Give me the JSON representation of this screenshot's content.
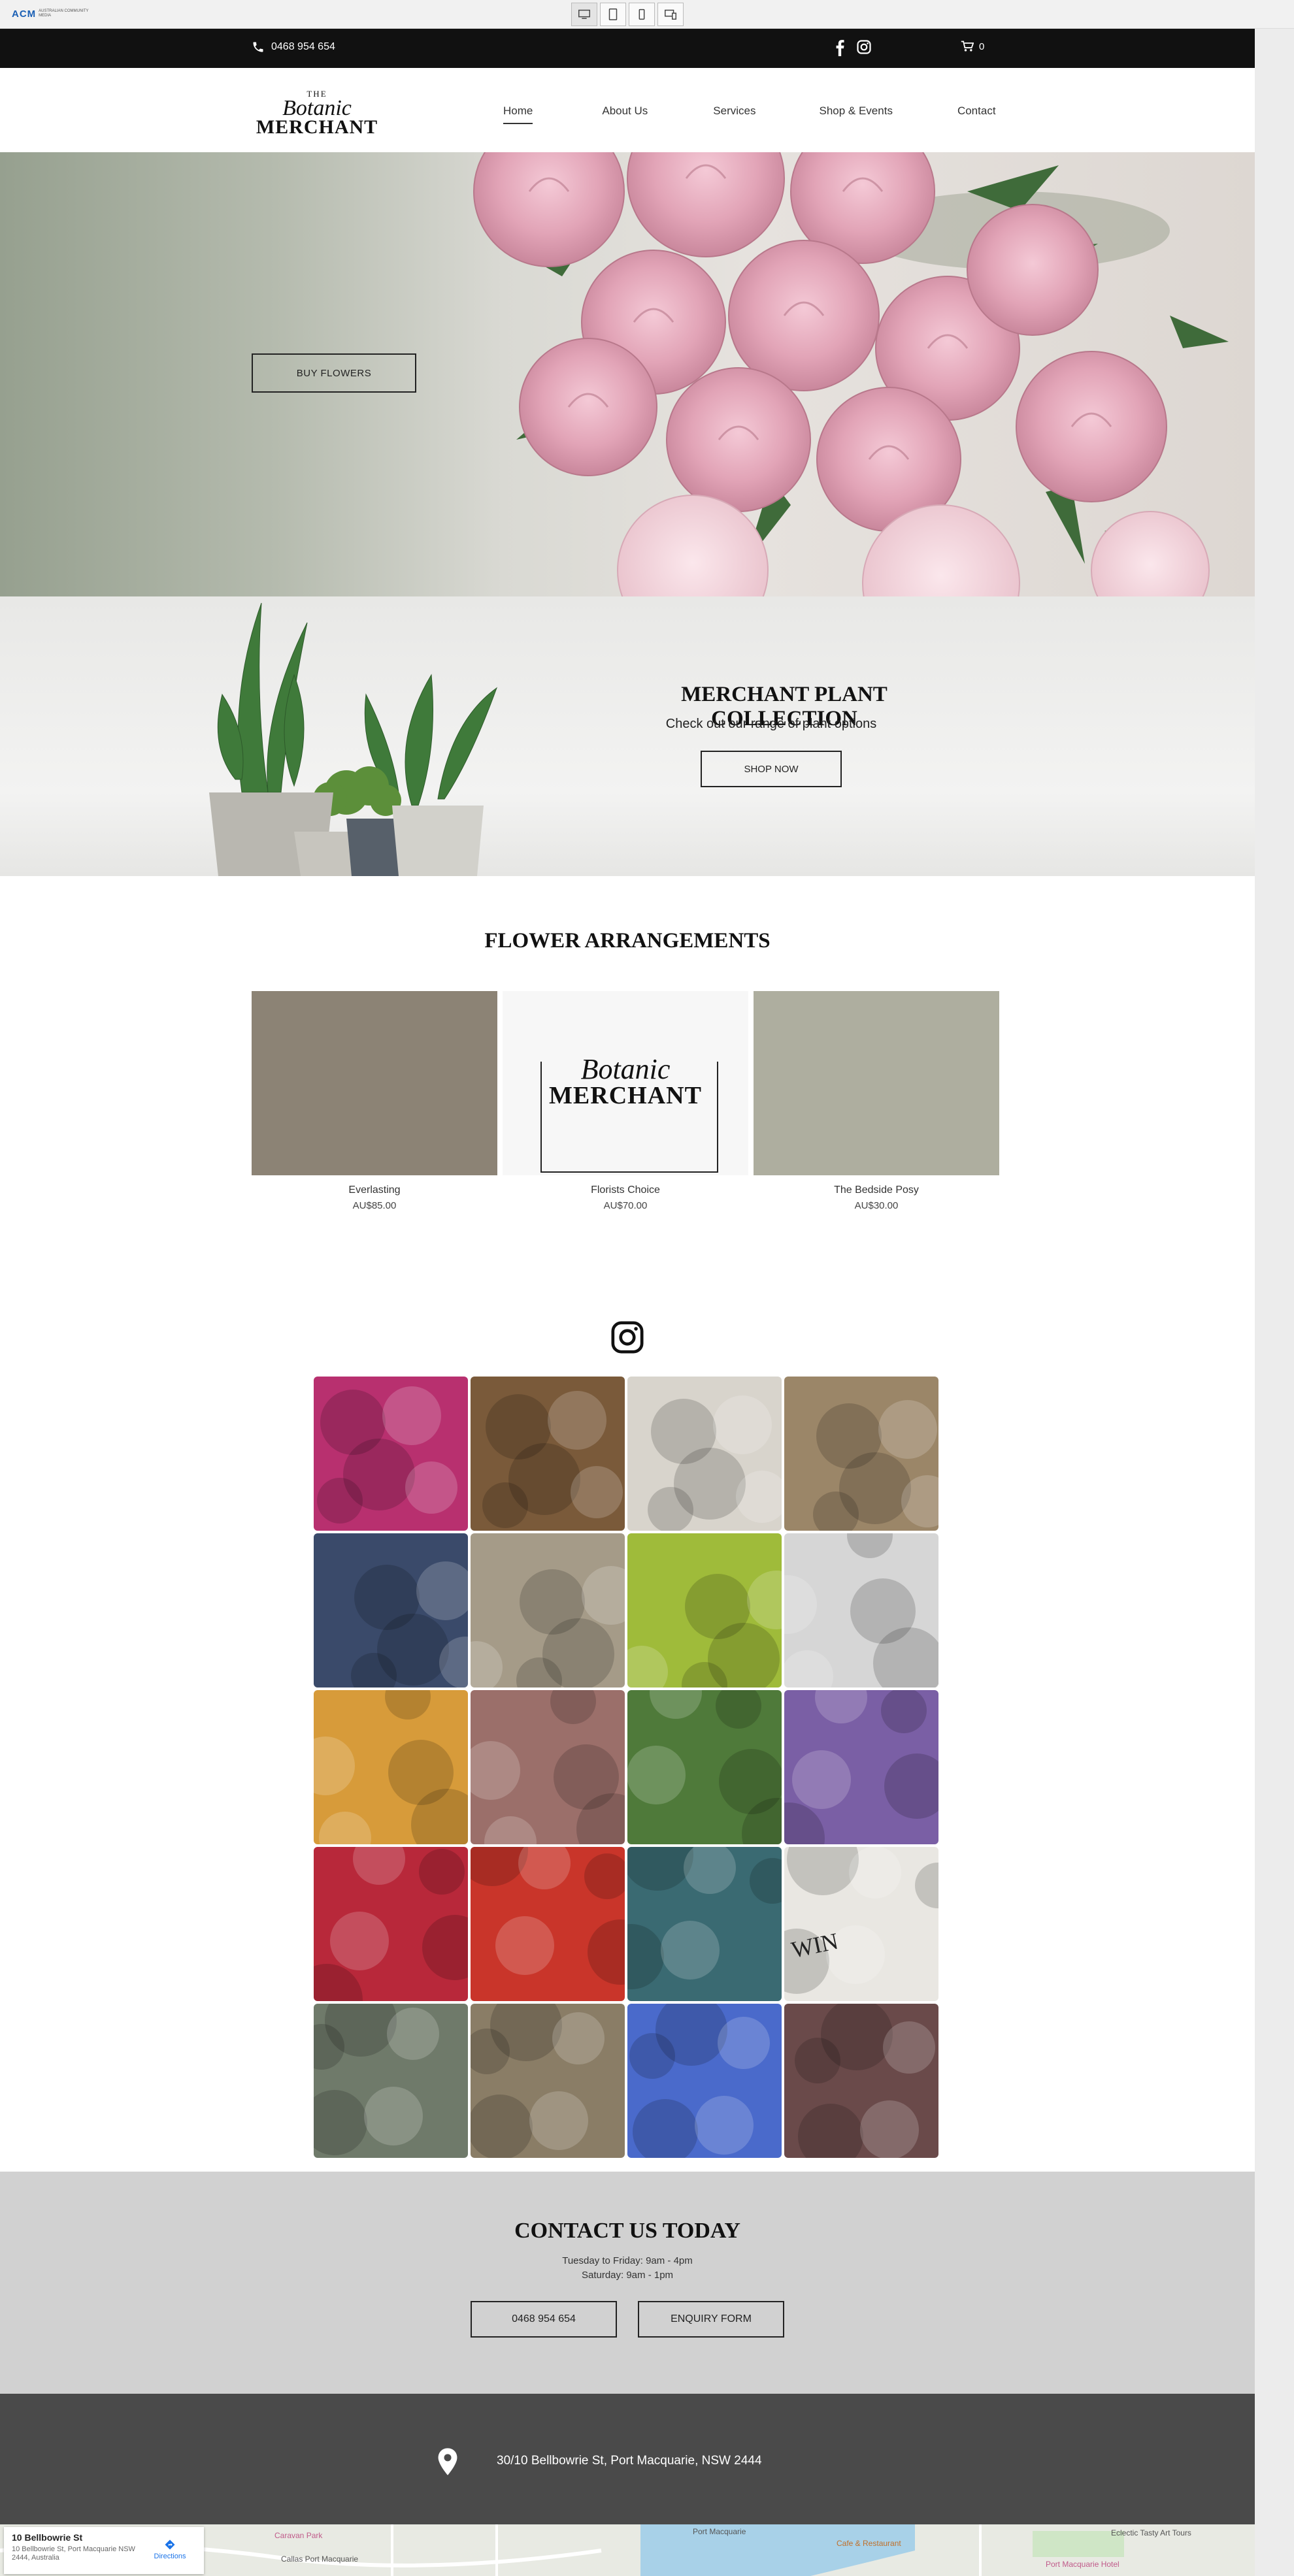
{
  "editor": {
    "logo_text": "ACM",
    "logo_sub": "AUSTRALIAN COMMUNITY MEDIA",
    "devices": [
      "desktop-icon",
      "tablet-icon",
      "mobile-icon",
      "responsive-icon"
    ]
  },
  "topbar": {
    "phone": "0468 954 654",
    "social": [
      "facebook-icon",
      "instagram-icon"
    ],
    "cart_count": "0"
  },
  "brand": {
    "the": "THE",
    "botanic": "Botanic",
    "merchant": "MERCHANT"
  },
  "nav": {
    "items": [
      "Home",
      "About Us",
      "Services",
      "Shop & Events",
      "Contact"
    ],
    "active": "Home"
  },
  "hero": {
    "button": "BUY FLOWERS"
  },
  "plants": {
    "title": "MERCHANT PLANT COLLECTION",
    "subtitle": "Check out our range of plant options",
    "button": "SHOP NOW"
  },
  "arrangements": {
    "title": "FLOWER ARRANGEMENTS",
    "items": [
      {
        "name": "Everlasting",
        "price": "AU$85.00",
        "color": "#8c8375"
      },
      {
        "name": "Florists Choice",
        "price": "AU$70.00",
        "color": "#f7f7f7"
      },
      {
        "name": "The Bedside Posy",
        "price": "AU$30.00",
        "color": "#aeae9f"
      }
    ],
    "placeholder_logo": {
      "botanic": "Botanic",
      "merchant": "MERCHANT"
    }
  },
  "instagram": {
    "icon": "instagram-icon",
    "tiles": [
      {
        "subject": "pink chrysanthemums",
        "bg": "#b8306f"
      },
      {
        "subject": "native bouquet",
        "bg": "#7a5a3a"
      },
      {
        "subject": "yellow billy buttons",
        "bg": "#d8d4cc"
      },
      {
        "subject": "woven baskets",
        "bg": "#9b8668"
      },
      {
        "subject": "purple bouquet",
        "bg": "#3a4a6a"
      },
      {
        "subject": "hanging planters",
        "bg": "#a59b88"
      },
      {
        "subject": "green roses",
        "bg": "#9fbb3a"
      },
      {
        "subject": "glassware shelves",
        "bg": "#d6d6d6"
      },
      {
        "subject": "poppies",
        "bg": "#d79b3a"
      },
      {
        "subject": "pink tulip buckets",
        "bg": "#9b6f6a"
      },
      {
        "subject": "white tulips",
        "bg": "#4f7a3a"
      },
      {
        "subject": "anemones",
        "bg": "#7a5fa5"
      },
      {
        "subject": "red celosia",
        "bg": "#b8283a"
      },
      {
        "subject": "red and orange bouquet",
        "bg": "#c9352a"
      },
      {
        "subject": "potted plants",
        "bg": "#3a6a72"
      },
      {
        "subject": "succulent giveaway",
        "bg": "#e9e7e2",
        "text": "WIN"
      },
      {
        "subject": "plant display",
        "bg": "#6f7a6a"
      },
      {
        "subject": "basket display",
        "bg": "#8a7d66"
      },
      {
        "subject": "rainbow roses",
        "bg": "#4a6acb"
      },
      {
        "subject": "protea",
        "bg": "#6a4a4a"
      }
    ]
  },
  "contact": {
    "title": "CONTACT US TODAY",
    "hours_weekday": "Tuesday to Friday: 9am - 4pm",
    "hours_saturday": "Saturday: 9am - 1pm",
    "phone_button": "0468 954 654",
    "enquiry_button": "ENQUIRY FORM"
  },
  "address": {
    "text": "30/10 Bellbowrie St, Port Macquarie, NSW 2444"
  },
  "map": {
    "card_title": "10 Bellbowrie St",
    "card_address": "10 Bellbowrie St, Port Macquarie NSW 2444, Australia",
    "directions": "Directions",
    "labels": [
      "Caravan Park",
      "Port Macquarie",
      "Eclectic Tasty Art Tours",
      "Callas Port Macquarie",
      "Cafe & Restaurant",
      "Port Macquarie Hotel"
    ]
  }
}
